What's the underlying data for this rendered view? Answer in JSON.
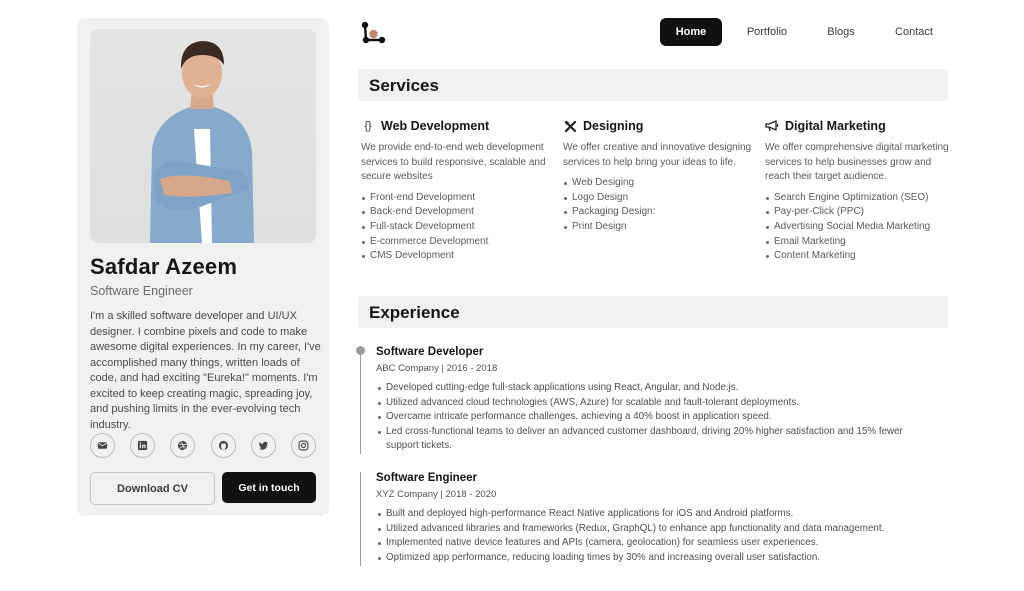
{
  "profile": {
    "name": "Safdar Azeem",
    "role": "Software Engineer",
    "bio": "I'm a skilled software developer and UI/UX designer. I combine pixels and code to make awesome digital experiences. In my career, I've accomplished many things, written loads of code, and had exciting \"Eureka!\" moments. I'm excited to keep creating magic, spreading joy, and pushing limits in the ever-evolving tech industry.",
    "socials": [
      "mail-icon",
      "linkedin-icon",
      "dribbble-icon",
      "github-icon",
      "twitter-icon",
      "instagram-icon"
    ],
    "download_cv_label": "Download CV",
    "contact_label": "Get in touch"
  },
  "nav": {
    "items": [
      "Home",
      "Portfolio",
      "Blogs",
      "Contact"
    ],
    "active": "Home"
  },
  "services": {
    "heading": "Services",
    "items": [
      {
        "icon": "code-braces-icon",
        "title": "Web Development",
        "description": "We provide end-to-end web development services to build responsive, scalable and secure websites",
        "list": [
          "Front-end Development",
          "Back-end Development",
          "Full-stack Development",
          "E-commerce Development",
          "CMS Development"
        ]
      },
      {
        "icon": "design-tools-icon",
        "title": "Designing",
        "description": "We offer creative and innovative designing services to help bring your ideas to life.",
        "list": [
          "Web Desiging",
          "Logo Design",
          "Packaging Design:",
          "Print Design"
        ]
      },
      {
        "icon": "megaphone-icon",
        "title": "Digital Marketing",
        "description": "We offer comprehensive digital marketing services to help businesses grow and reach their target audience.",
        "list": [
          "Search Engine Optimization (SEO)",
          "Pay-per-Click (PPC)",
          "Advertising Social Media Marketing",
          "Email Marketing",
          "Content Marketing"
        ]
      }
    ]
  },
  "experience": {
    "heading": "Experience",
    "jobs": [
      {
        "title": "Software Developer",
        "meta": "ABC Company | 2016 - 2018",
        "points": [
          "Developed cutting-edge full-stack applications using React, Angular, and Node.js.",
          "Utilized advanced cloud technologies (AWS, Azure) for scalable and fault-tolerant deployments.",
          "Overcame intricate performance challenges, achieving a 40% boost in application speed.",
          "Led cross-functional teams to deliver an advanced customer dashboard, driving 20% higher satisfaction and 15% fewer support tickets."
        ]
      },
      {
        "title": "Software Engineer",
        "meta": "XYZ Company | 2018 - 2020",
        "points": [
          "Built and deployed high-performance React Native applications for iOS and Android platforms.",
          "Utilized advanced libraries and frameworks (Redux, GraphQL) to enhance app functionality and data management.",
          "Implemented native device features and APIs (camera, geolocation) for seamless user experiences.",
          "Optimized app performance, reducing loading times by 30% and increasing overall user satisfaction."
        ]
      }
    ]
  },
  "colors": {
    "accent_dark": "#111111",
    "logo_accent": "#c0876b",
    "card_bg": "#f1f1f1"
  }
}
